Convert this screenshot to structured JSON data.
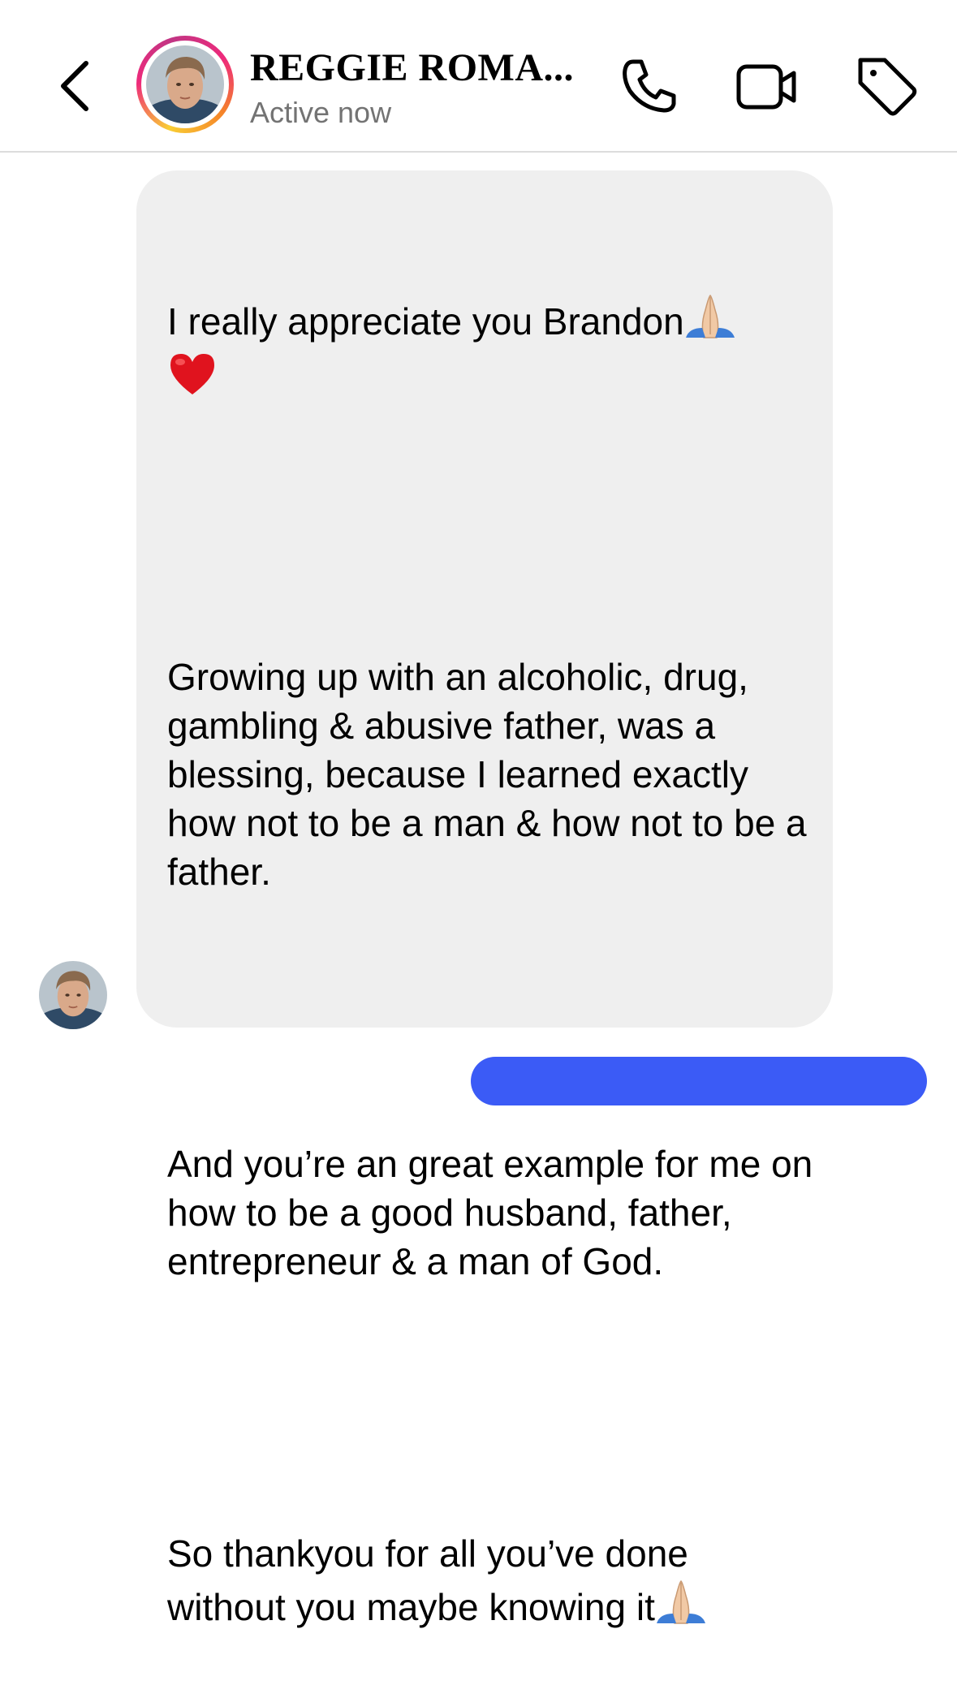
{
  "header": {
    "contact_name": "REGGIE ROMA...",
    "status": "Active now",
    "back_icon": "chevron-left-icon",
    "phone_icon": "phone-icon",
    "video_icon": "video-camera-icon",
    "tag_icon": "tag-icon"
  },
  "messages": [
    {
      "sender": "REGGIE ROMA...",
      "paragraphs": {
        "p1": "I really appreciate you Brandon",
        "p2": "Growing up with an alcoholic, drug, gambling & abusive father, was a blessing, because I learned exactly how not to be a man & how not to be a father.",
        "p3": "And you’re an great example for me on how to be a good husband, father, entrepreneur & a man of God.",
        "p4": "So thankyou for all you’ve done without you maybe knowing it"
      },
      "emojis": [
        "folded-hands",
        "red-heart",
        "folded-hands"
      ]
    }
  ],
  "colors": {
    "incoming_bubble": "#efefef",
    "outgoing_bubble": "#3b5bf6",
    "status_text": "#737373",
    "divider": "#dcdcdc"
  }
}
